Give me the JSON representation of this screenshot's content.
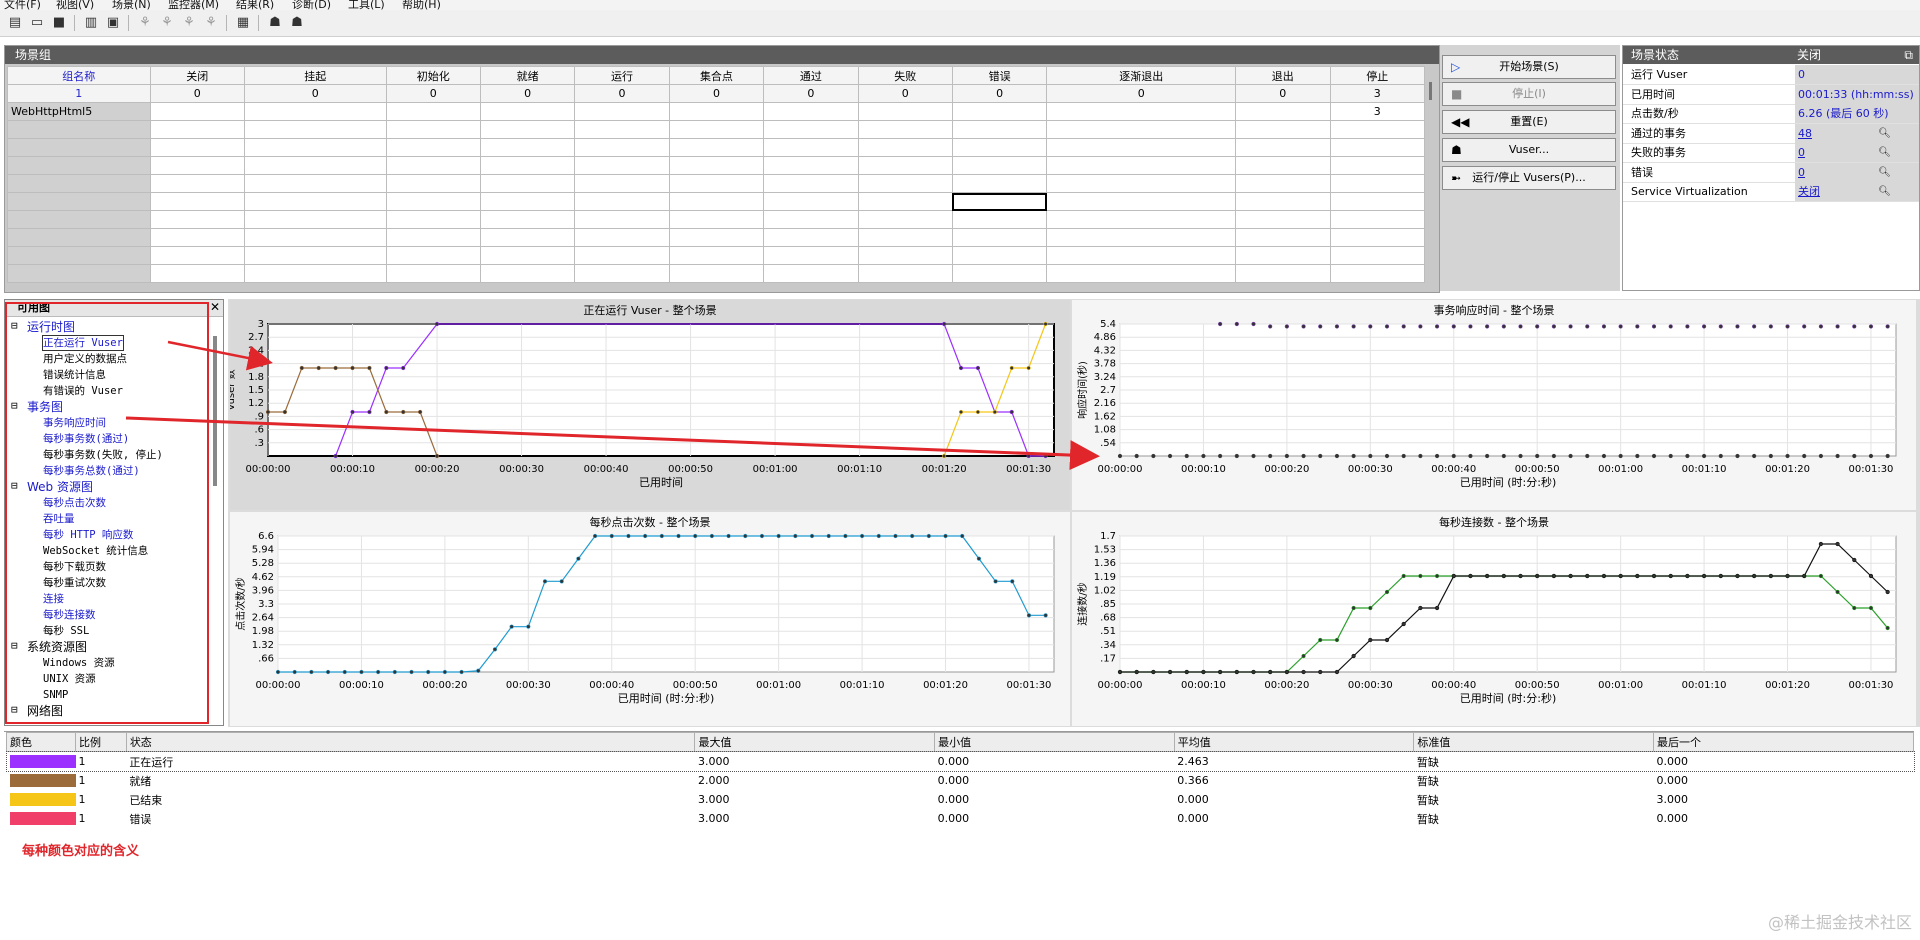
{
  "menu": [
    "文件(F)",
    "视图(V)",
    "场景(N)",
    "监控器(M)",
    "结果(R)",
    "诊断(D)",
    "工具(L)",
    "帮助(H)"
  ],
  "scenario_groups": {
    "title": "场景组",
    "columns": [
      "组名称",
      "关闭",
      "挂起",
      "初始化",
      "就绪",
      "运行",
      "集合点",
      "通过",
      "失败",
      "错误",
      "逐渐退出",
      "退出",
      "停止"
    ],
    "counts": [
      "1",
      "0",
      "0",
      "0",
      "0",
      "0",
      "0",
      "0",
      "0",
      "0",
      "0",
      "0",
      "3"
    ],
    "rows": [
      [
        "WebHttpHtml5",
        "",
        "",
        "",
        "",
        "",
        "",
        "",
        "",
        "",
        "",
        "",
        "3"
      ]
    ]
  },
  "buttons": {
    "start": "开始场景(S)",
    "stop": "停止(I)",
    "reset": "重置(E)",
    "vuser": "Vuser...",
    "run_stop_vusers": "运行/停止 Vusers(P)..."
  },
  "scenario_status": {
    "title": "场景状态",
    "state": "关闭",
    "rows": [
      {
        "label": "运行 Vuser",
        "value": "0",
        "search": false,
        "link": false
      },
      {
        "label": "已用时间",
        "value": "00:01:33 (hh:mm:ss)",
        "search": false,
        "link": false
      },
      {
        "label": "点击数/秒",
        "value": "6.26 (最后 60 秒)",
        "search": false,
        "link": false
      },
      {
        "label": "通过的事务",
        "value": "48",
        "search": true,
        "link": true
      },
      {
        "label": "失败的事务",
        "value": "0",
        "search": true,
        "link": true
      },
      {
        "label": "错误",
        "value": "0",
        "search": true,
        "link": true
      },
      {
        "label": "Service Virtualization",
        "value": "关闭",
        "search": true,
        "link": true
      }
    ]
  },
  "available_graphs": {
    "title": "可用图",
    "items": [
      {
        "text": "运行时图",
        "type": "cat"
      },
      {
        "text": "正在运行 Vuser",
        "type": "blue",
        "boxed": true
      },
      {
        "text": "用户定义的数据点",
        "type": "item"
      },
      {
        "text": "错误统计信息",
        "type": "item"
      },
      {
        "text": "有错误的 Vuser",
        "type": "item"
      },
      {
        "text": "事务图",
        "type": "cat"
      },
      {
        "text": "事务响应时间",
        "type": "blue"
      },
      {
        "text": "每秒事务数(通过)",
        "type": "blue"
      },
      {
        "text": "每秒事务数(失败, 停止)",
        "type": "item"
      },
      {
        "text": "每秒事务总数(通过)",
        "type": "blue"
      },
      {
        "text": "Web 资源图",
        "type": "cat"
      },
      {
        "text": "每秒点击次数",
        "type": "blue"
      },
      {
        "text": "吞吐量",
        "type": "blue"
      },
      {
        "text": "每秒 HTTP 响应数",
        "type": "blue"
      },
      {
        "text": "WebSocket 统计信息",
        "type": "item"
      },
      {
        "text": "每秒下载页数",
        "type": "item"
      },
      {
        "text": "每秒重试次数",
        "type": "item"
      },
      {
        "text": "连接",
        "type": "blue"
      },
      {
        "text": "每秒连接数",
        "type": "blue"
      },
      {
        "text": "每秒 SSL",
        "type": "item"
      },
      {
        "text": "系统资源图",
        "type": "cat-black"
      },
      {
        "text": "Windows 资源",
        "type": "item"
      },
      {
        "text": "UNIX 资源",
        "type": "item"
      },
      {
        "text": "SNMP",
        "type": "item"
      },
      {
        "text": "网络图",
        "type": "cat-black"
      }
    ]
  },
  "chart_data": [
    {
      "type": "line",
      "title": "正在运行 Vuser - 整个场景",
      "xlabel": "已用时间",
      "ylabel": "Vuser 数",
      "xlim": [
        0,
        93
      ],
      "ylim": [
        0,
        3
      ],
      "xticks": [
        "00:00:00",
        "00:00:10",
        "00:00:20",
        "00:00:30",
        "00:00:40",
        "00:00:50",
        "00:01:00",
        "00:01:10",
        "00:01:20",
        "00:01:30"
      ],
      "yticks": [
        "3",
        "2.7",
        "2.4",
        "2.1",
        "1.8",
        "1.5",
        "1.2",
        ".9",
        ".6",
        ".3"
      ],
      "series": [
        {
          "color": "#9b30ff",
          "x": [
            8,
            10,
            12,
            14,
            16,
            20,
            80,
            82,
            84,
            86,
            88,
            90,
            92
          ],
          "y": [
            0,
            1,
            1,
            2,
            2,
            3,
            3,
            2,
            2,
            1,
            1,
            0,
            0
          ]
        },
        {
          "color": "#9b6b3a",
          "x": [
            0,
            2,
            4,
            6,
            8,
            10,
            12,
            14,
            16,
            18,
            20
          ],
          "y": [
            1,
            1,
            2,
            2,
            2,
            2,
            2,
            1,
            1,
            1,
            0
          ]
        },
        {
          "color": "#f5c518",
          "x": [
            80,
            82,
            84,
            86,
            88,
            90,
            92
          ],
          "y": [
            0,
            1,
            1,
            1,
            2,
            2,
            3
          ]
        }
      ]
    },
    {
      "type": "scatter",
      "title": "事务响应时间 - 整个场景",
      "xlabel": "已用时间 (时:分:秒)",
      "ylabel": "响应时间(秒)",
      "xlim": [
        0,
        93
      ],
      "ylim": [
        0,
        5.4
      ],
      "xticks": [
        "00:00:00",
        "00:00:10",
        "00:00:20",
        "00:00:30",
        "00:00:40",
        "00:00:50",
        "00:01:00",
        "00:01:10",
        "00:01:20",
        "00:01:30"
      ],
      "yticks": [
        "5.4",
        "4.86",
        "4.32",
        "3.78",
        "3.24",
        "2.7",
        "2.16",
        "1.62",
        "1.08",
        ".54"
      ],
      "series": [
        {
          "color": "#7a3fb0",
          "x": [
            12,
            14,
            16,
            18,
            20,
            22,
            24,
            26,
            28,
            30,
            32,
            34,
            36,
            38,
            40,
            42,
            44,
            46,
            48,
            50,
            52,
            54,
            56,
            58,
            60,
            62,
            64,
            66,
            68,
            70,
            72,
            74,
            76,
            78,
            80,
            82,
            84,
            86,
            88,
            90,
            92
          ],
          "y": [
            5.4,
            5.4,
            5.4,
            5.3,
            5.3,
            5.3,
            5.3,
            5.3,
            5.3,
            5.3,
            5.3,
            5.3,
            5.3,
            5.3,
            5.3,
            5.3,
            5.3,
            5.3,
            5.3,
            5.3,
            5.3,
            5.3,
            5.3,
            5.3,
            5.3,
            5.3,
            5.3,
            5.3,
            5.3,
            5.3,
            5.3,
            5.3,
            5.3,
            5.3,
            5.3,
            5.3,
            5.3,
            5.3,
            5.3,
            5.3,
            5.3
          ]
        },
        {
          "color": "#444444",
          "x": [
            0,
            2,
            4,
            6,
            8,
            10,
            12,
            14,
            16,
            18,
            20,
            22,
            24,
            26,
            28,
            30,
            32,
            34,
            36,
            38,
            40,
            42,
            44,
            46,
            48,
            50,
            52,
            54,
            56,
            58,
            60,
            62,
            64,
            66,
            68,
            70,
            72,
            74,
            76,
            78,
            80,
            82,
            84,
            86,
            88,
            90,
            92
          ],
          "y": [
            0,
            0,
            0,
            0,
            0,
            0,
            0,
            0,
            0,
            0,
            0,
            0,
            0,
            0,
            0,
            0,
            0,
            0,
            0,
            0,
            0,
            0,
            0,
            0,
            0,
            0,
            0,
            0,
            0,
            0,
            0,
            0,
            0,
            0,
            0,
            0,
            0,
            0,
            0,
            0,
            0,
            0,
            0,
            0,
            0,
            0,
            0
          ]
        }
      ]
    },
    {
      "type": "line",
      "title": "每秒点击次数 - 整个场景",
      "xlabel": "已用时间 (时:分:秒)",
      "ylabel": "点击次数/秒",
      "xlim": [
        0,
        93
      ],
      "ylim": [
        0,
        6.6
      ],
      "xticks": [
        "00:00:00",
        "00:00:10",
        "00:00:20",
        "00:00:30",
        "00:00:40",
        "00:00:50",
        "00:01:00",
        "00:01:10",
        "00:01:20",
        "00:01:30"
      ],
      "yticks": [
        "6.6",
        "5.94",
        "5.28",
        "4.62",
        "3.96",
        "3.3",
        "2.64",
        "1.98",
        "1.32",
        ".66"
      ],
      "series": [
        {
          "color": "#1f9bd1",
          "x": [
            0,
            2,
            4,
            6,
            8,
            10,
            12,
            14,
            16,
            18,
            20,
            22,
            24,
            26,
            28,
            30,
            32,
            34,
            36,
            38,
            40,
            42,
            44,
            46,
            48,
            50,
            52,
            54,
            56,
            58,
            60,
            62,
            64,
            66,
            68,
            70,
            72,
            74,
            76,
            78,
            80,
            82,
            84,
            86,
            88,
            90,
            92
          ],
          "y": [
            0,
            0,
            0,
            0,
            0,
            0,
            0,
            0,
            0,
            0,
            0,
            0,
            0.06,
            1.1,
            2.2,
            2.2,
            4.4,
            4.4,
            5.5,
            6.6,
            6.6,
            6.6,
            6.6,
            6.6,
            6.6,
            6.6,
            6.6,
            6.6,
            6.6,
            6.6,
            6.6,
            6.6,
            6.6,
            6.6,
            6.6,
            6.6,
            6.6,
            6.6,
            6.6,
            6.6,
            6.6,
            6.6,
            5.5,
            4.4,
            4.4,
            2.75,
            2.75
          ]
        }
      ]
    },
    {
      "type": "line",
      "title": "每秒连接数 - 整个场景",
      "xlabel": "已用时间 (时:分:秒)",
      "ylabel": "连接数/秒",
      "xlim": [
        0,
        93
      ],
      "ylim": [
        0,
        1.7
      ],
      "xticks": [
        "00:00:00",
        "00:00:10",
        "00:00:20",
        "00:00:30",
        "00:00:40",
        "00:00:50",
        "00:01:00",
        "00:01:10",
        "00:01:20",
        "00:01:30"
      ],
      "yticks": [
        "1.7",
        "1.53",
        "1.36",
        "1.19",
        "1.02",
        ".85",
        ".68",
        ".51",
        ".34",
        ".17"
      ],
      "series": [
        {
          "color": "#2aa02a",
          "x": [
            0,
            2,
            4,
            6,
            8,
            10,
            12,
            14,
            16,
            18,
            20,
            22,
            24,
            26,
            28,
            30,
            32,
            34,
            36,
            38,
            40,
            42,
            44,
            46,
            48,
            50,
            52,
            54,
            56,
            58,
            60,
            62,
            64,
            66,
            68,
            70,
            72,
            74,
            76,
            78,
            80,
            82,
            84,
            86,
            88,
            90,
            92
          ],
          "y": [
            0,
            0,
            0,
            0,
            0,
            0,
            0,
            0,
            0,
            0,
            0,
            0.2,
            0.4,
            0.4,
            0.8,
            0.8,
            1.0,
            1.2,
            1.2,
            1.2,
            1.2,
            1.2,
            1.2,
            1.2,
            1.2,
            1.2,
            1.2,
            1.2,
            1.2,
            1.2,
            1.2,
            1.2,
            1.2,
            1.2,
            1.2,
            1.2,
            1.2,
            1.2,
            1.2,
            1.2,
            1.2,
            1.2,
            1.2,
            1.0,
            0.8,
            0.8,
            0.55
          ]
        },
        {
          "color": "#111111",
          "x": [
            0,
            2,
            4,
            6,
            8,
            10,
            12,
            14,
            16,
            18,
            20,
            22,
            24,
            26,
            28,
            30,
            32,
            34,
            36,
            38,
            40,
            42,
            44,
            46,
            48,
            50,
            52,
            54,
            56,
            58,
            60,
            62,
            64,
            66,
            68,
            70,
            72,
            74,
            76,
            78,
            80,
            82,
            84,
            86,
            88,
            90,
            92
          ],
          "y": [
            0,
            0,
            0,
            0,
            0,
            0,
            0,
            0,
            0,
            0,
            0,
            0,
            0,
            0,
            0.2,
            0.4,
            0.4,
            0.6,
            0.8,
            0.8,
            1.2,
            1.2,
            1.2,
            1.2,
            1.2,
            1.2,
            1.2,
            1.2,
            1.2,
            1.2,
            1.2,
            1.2,
            1.2,
            1.2,
            1.2,
            1.2,
            1.2,
            1.2,
            1.2,
            1.2,
            1.2,
            1.2,
            1.6,
            1.6,
            1.4,
            1.2,
            1.0
          ]
        }
      ]
    }
  ],
  "legend": {
    "columns": [
      "颜色",
      "比例",
      "状态",
      "最大值",
      "最小值",
      "平均值",
      "标准值",
      "最后一个"
    ],
    "rows": [
      {
        "color": "#9b30ff",
        "scale": "1",
        "status": "正在运行",
        "max": "3.000",
        "min": "0.000",
        "avg": "2.463",
        "std": "暂缺",
        "last": "0.000"
      },
      {
        "color": "#9b6b3a",
        "scale": "1",
        "status": "就绪",
        "max": "2.000",
        "min": "0.000",
        "avg": "0.366",
        "std": "暂缺",
        "last": "0.000"
      },
      {
        "color": "#f5c518",
        "scale": "1",
        "status": "已结束",
        "max": "3.000",
        "min": "0.000",
        "avg": "0.000",
        "std": "暂缺",
        "last": "3.000"
      },
      {
        "color": "#f0406a",
        "scale": "1",
        "status": "错误",
        "max": "3.000",
        "min": "0.000",
        "avg": "0.000",
        "std": "暂缺",
        "last": "0.000"
      }
    ],
    "note": "每种颜色对应的含义"
  },
  "watermark": "@稀土掘金技术社区",
  "colors": {
    "accent_red": "#e0262b",
    "panel_header": "#5c5c5c",
    "link_blue": "#1a1acc"
  }
}
